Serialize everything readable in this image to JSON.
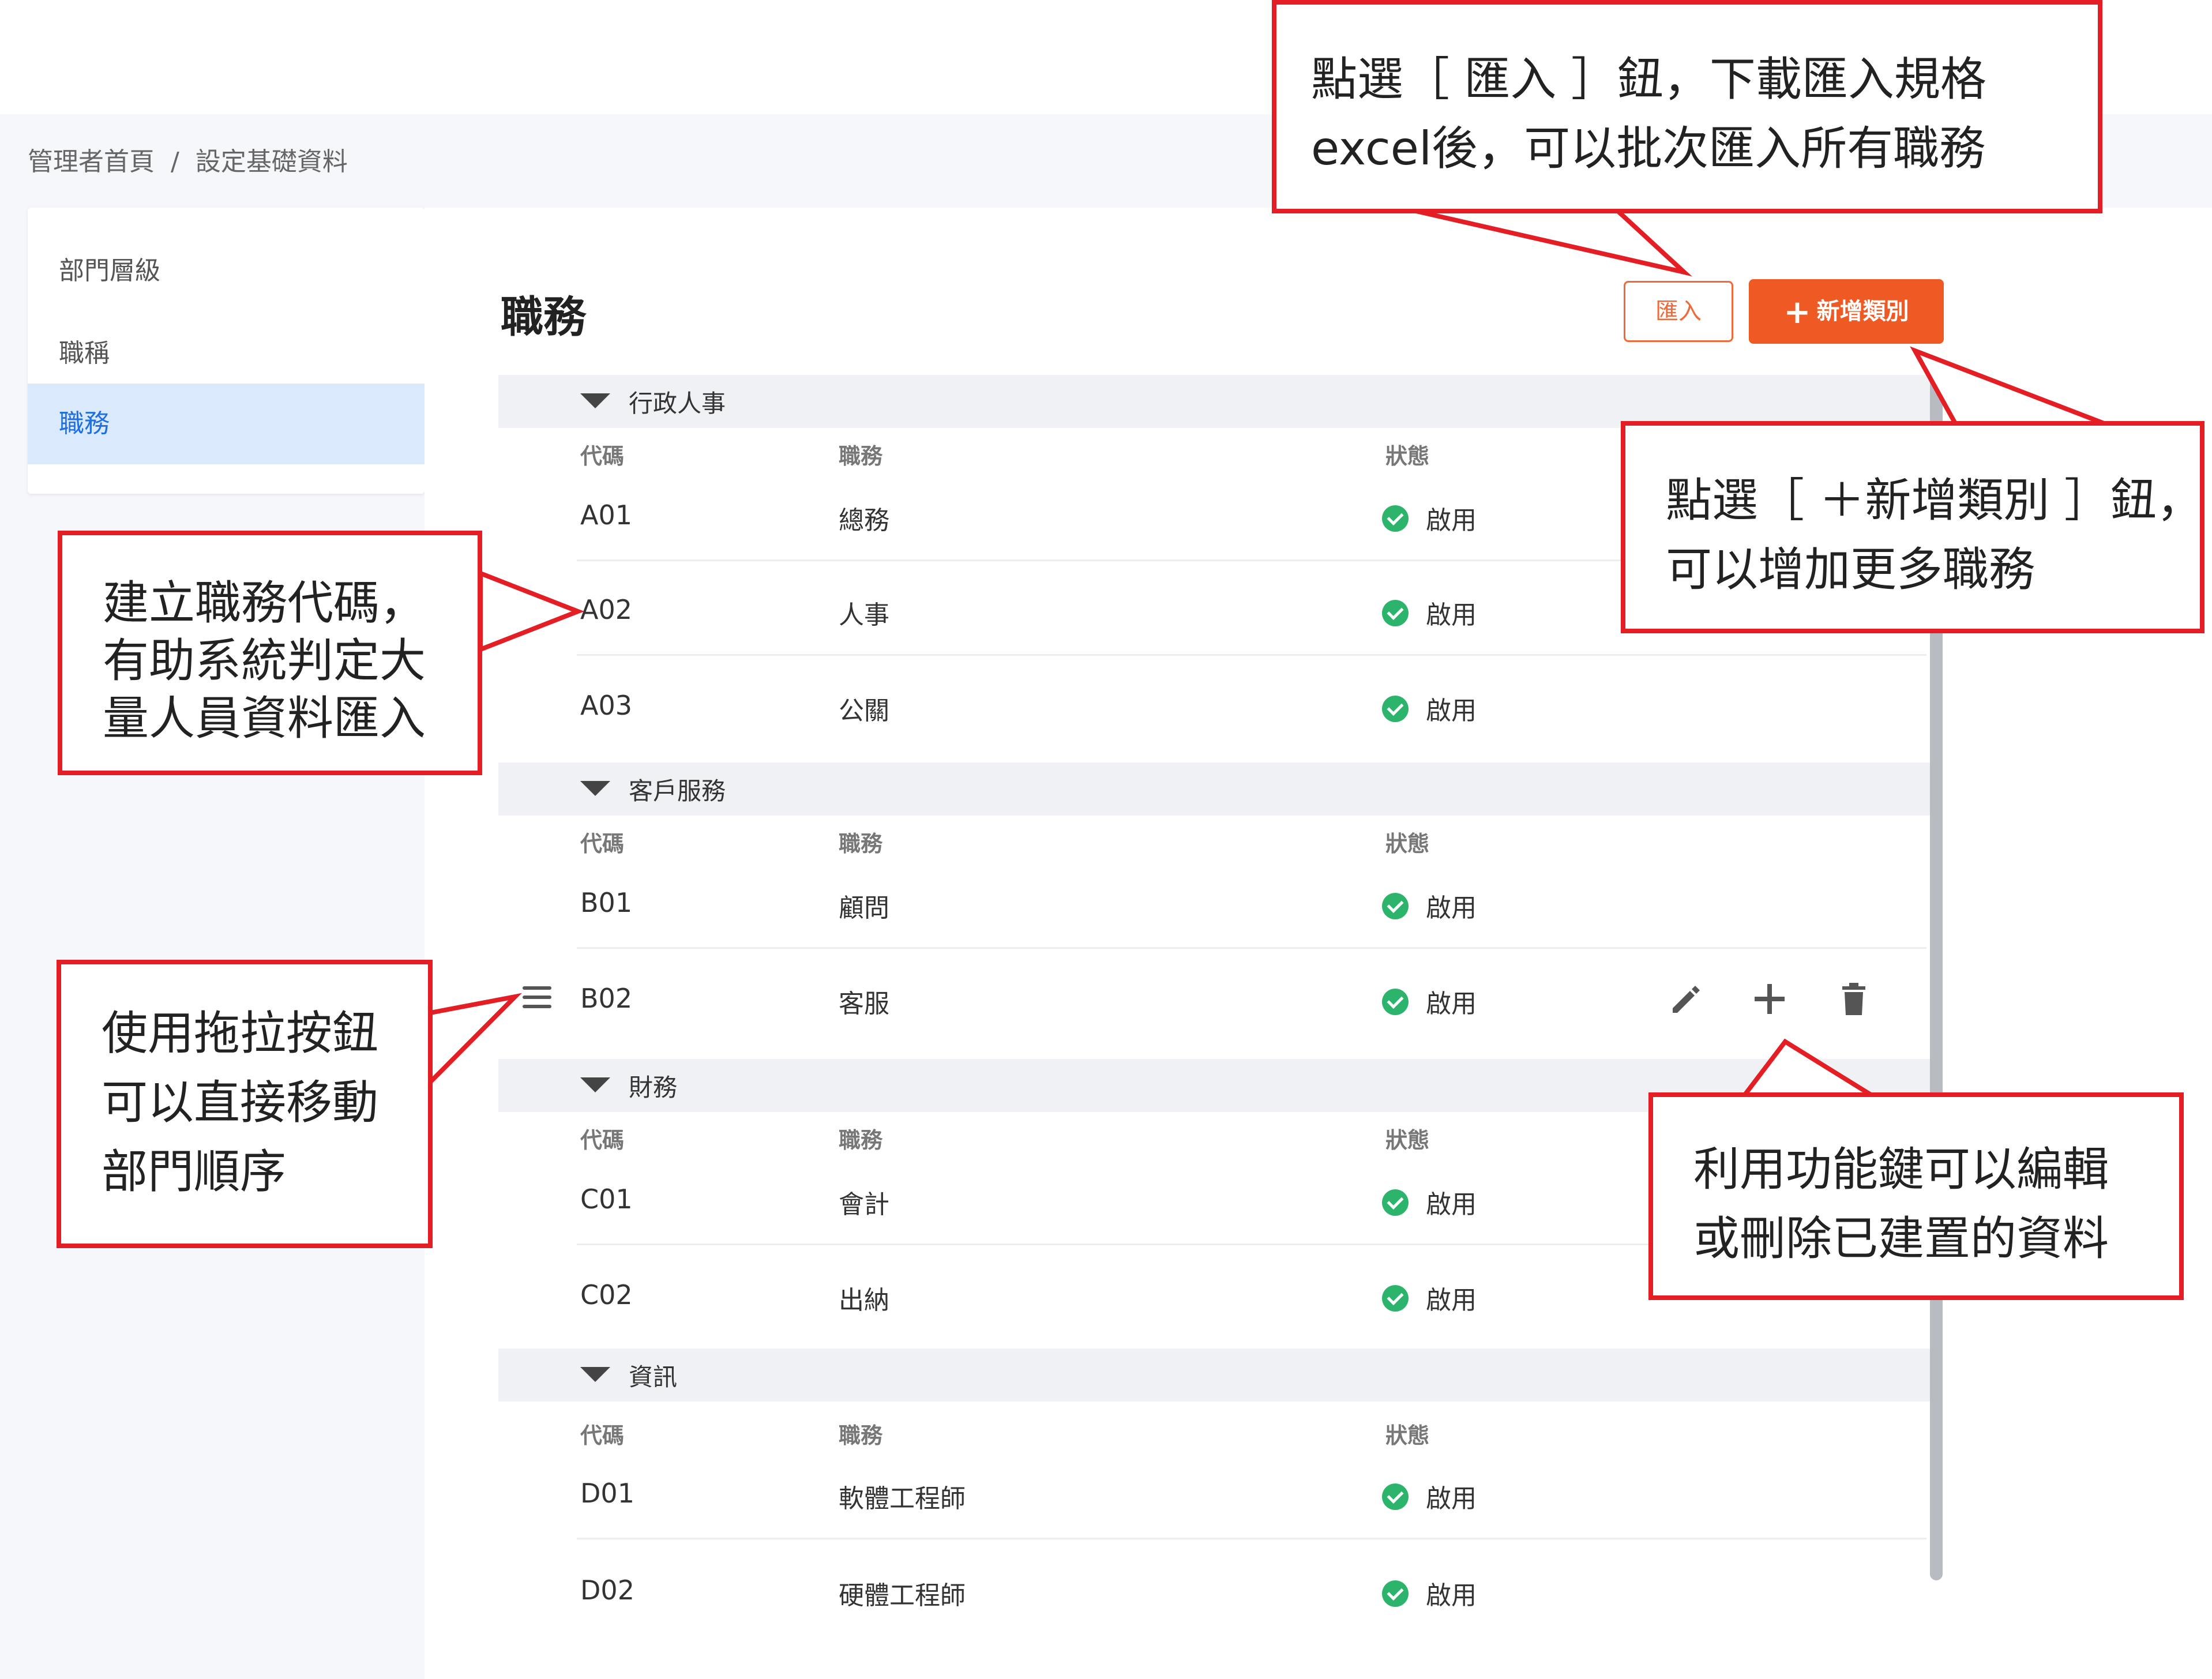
{
  "breadcrumb": {
    "home": "管理者首頁",
    "separator": "/",
    "current": "設定基礎資料"
  },
  "sidebar": {
    "items": [
      {
        "label": "部門層級",
        "active": false
      },
      {
        "label": "職稱",
        "active": false
      },
      {
        "label": "職務",
        "active": true
      }
    ]
  },
  "page": {
    "title": "職務",
    "import_label": "匯入",
    "add_category_label": "新增類別",
    "add_category_icon": "plus-icon"
  },
  "columns": {
    "code": "代碼",
    "duty": "職務",
    "status": "狀態"
  },
  "groups": [
    {
      "name": "行政人事",
      "rows": [
        {
          "code": "A01",
          "duty": "總務",
          "status": "啟用"
        },
        {
          "code": "A02",
          "duty": "人事",
          "status": "啟用"
        },
        {
          "code": "A03",
          "duty": "公關",
          "status": "啟用"
        }
      ]
    },
    {
      "name": "客戶服務",
      "rows": [
        {
          "code": "B01",
          "duty": "顧問",
          "status": "啟用"
        },
        {
          "code": "B02",
          "duty": "客服",
          "status": "啟用"
        }
      ]
    },
    {
      "name": "財務",
      "rows": [
        {
          "code": "C01",
          "duty": "會計",
          "status": "啟用"
        },
        {
          "code": "C02",
          "duty": "出納",
          "status": "啟用"
        }
      ]
    },
    {
      "name": "資訊",
      "rows": [
        {
          "code": "D01",
          "duty": "軟體工程師",
          "status": "啟用"
        },
        {
          "code": "D02",
          "duty": "硬體工程師",
          "status": "啟用"
        }
      ]
    }
  ],
  "row_actions": [
    "edit-icon",
    "add-icon",
    "delete-icon"
  ],
  "colors": {
    "accent": "#ef5a24",
    "callout_border": "#e31e24",
    "status_ok": "#2db46c",
    "active_bg": "#dbe9fd"
  },
  "callouts": {
    "import": {
      "line1": "點選［ 匯入 ］鈕，下載匯入規格",
      "line2": "excel後，可以批次匯入所有職務"
    },
    "add_category": {
      "line1": "點選［ ＋新增類別 ］鈕，",
      "line2": "可以增加更多職務"
    },
    "code": {
      "line1": "建立職務代碼，",
      "line2": "有助系統判定大",
      "line3": "量人員資料匯入"
    },
    "drag": {
      "line1": "使用拖拉按鈕",
      "line2": "可以直接移動",
      "line3": "部門順序"
    },
    "actions": {
      "line1": "利用功能鍵可以編輯",
      "line2": "或刪除已建置的資料"
    }
  }
}
